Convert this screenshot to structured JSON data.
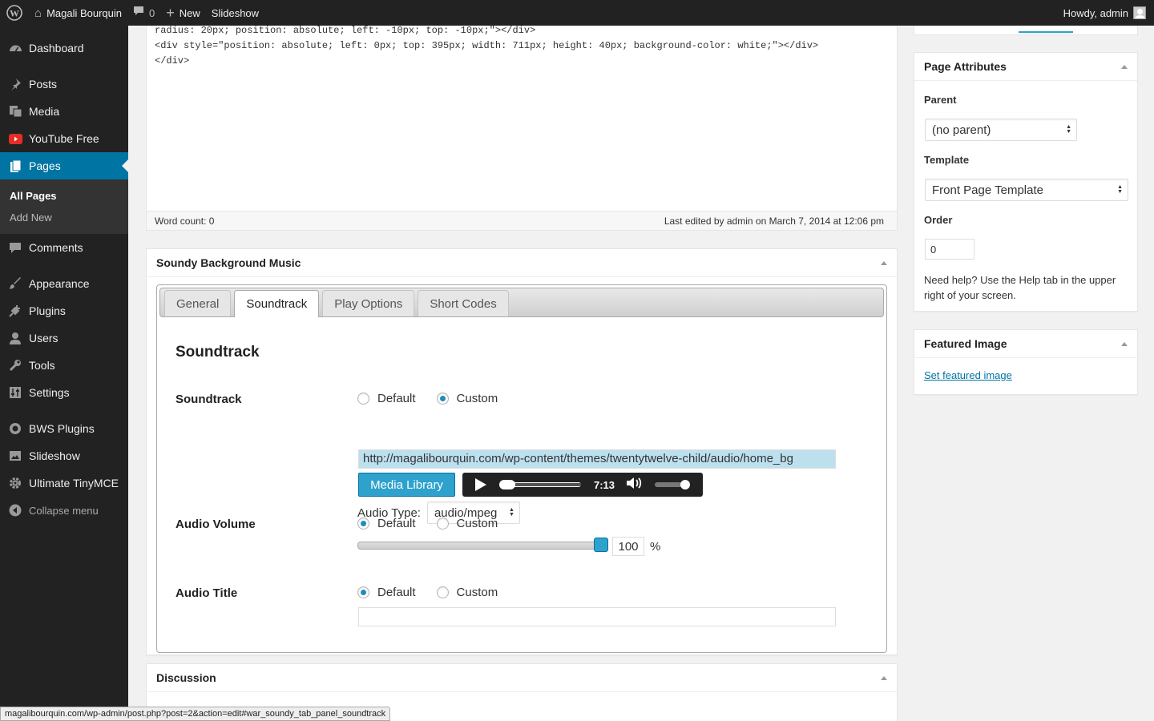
{
  "adminbar": {
    "site_name": "Magali Bourquin",
    "comments_count": "0",
    "new_label": "New",
    "slideshow_label": "Slideshow",
    "howdy": "Howdy, admin"
  },
  "menu": {
    "dashboard": "Dashboard",
    "posts": "Posts",
    "media": "Media",
    "youtube": "YouTube Free",
    "pages": "Pages",
    "all_pages": "All Pages",
    "add_new": "Add New",
    "comments": "Comments",
    "appearance": "Appearance",
    "plugins": "Plugins",
    "users": "Users",
    "tools": "Tools",
    "settings": "Settings",
    "bws_plugins": "BWS Plugins",
    "slideshow": "Slideshow",
    "ultimate_tinymce": "Ultimate TinyMCE",
    "collapse": "Collapse menu"
  },
  "editor": {
    "code": "radius: 20px; position: absolute; left: -10px; top: -10px;\"></div>\n<div style=\"position: absolute; left: 0px; top: 395px; width: 711px; height: 40px; background-color: white;\"></div>\n</div>",
    "word_count": "Word count: 0",
    "last_edited": "Last edited by admin on March 7, 2014 at 12:06 pm"
  },
  "soundy": {
    "title": "Soundy Background Music",
    "tabs": [
      "General",
      "Soundtrack",
      "Play Options",
      "Short Codes"
    ],
    "section_title": "Soundtrack",
    "soundtrack_label": "Soundtrack",
    "default_label": "Default",
    "custom_label": "Custom",
    "url": "http://magalibourquin.com/wp-content/themes/twentytwelve-child/audio/home_bg",
    "media_library": "Media Library",
    "time": "7:13",
    "audio_type_label": "Audio Type:",
    "audio_type_value": "audio/mpeg",
    "volume_label": "Audio Volume",
    "volume_value": "100",
    "volume_unit": "%",
    "title_label": "Audio Title"
  },
  "discussion": {
    "title": "Discussion"
  },
  "page_attributes": {
    "title": "Page Attributes",
    "parent_label": "Parent",
    "parent_value": "(no parent)",
    "template_label": "Template",
    "template_value": "Front Page Template",
    "order_label": "Order",
    "order_value": "0",
    "help": "Need help? Use the Help tab in the upper right of your screen."
  },
  "featured_image": {
    "title": "Featured Image",
    "link": "Set featured image"
  },
  "status_url": "magalibourquin.com/wp-admin/post.php?post=2&action=edit#war_soundy_tab_panel_soundtrack",
  "colors": {
    "admin_bg": "#222222",
    "accent": "#0074a2",
    "button": "#2ea2cc"
  }
}
